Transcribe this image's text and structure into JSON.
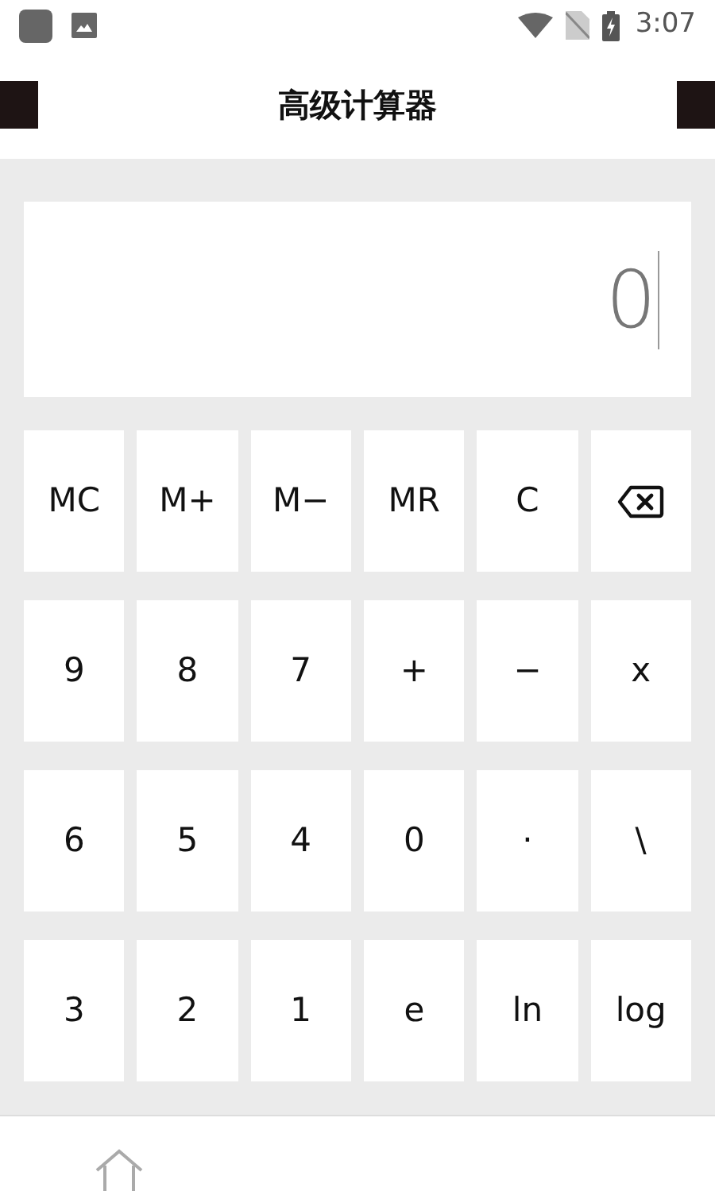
{
  "status_bar": {
    "time": "3:07"
  },
  "header": {
    "title": "高级计算器"
  },
  "display": {
    "value": "0"
  },
  "keys": [
    [
      {
        "kind": "text",
        "label": "MC"
      },
      {
        "kind": "text",
        "label": "M+"
      },
      {
        "kind": "text",
        "label": "M−"
      },
      {
        "kind": "text",
        "label": "MR"
      },
      {
        "kind": "text",
        "label": "C"
      },
      {
        "kind": "backspace"
      }
    ],
    [
      {
        "kind": "text",
        "label": "9"
      },
      {
        "kind": "text",
        "label": "8"
      },
      {
        "kind": "text",
        "label": "7"
      },
      {
        "kind": "text",
        "label": "+"
      },
      {
        "kind": "text",
        "label": "−"
      },
      {
        "kind": "text",
        "label": "x"
      }
    ],
    [
      {
        "kind": "text",
        "label": "6"
      },
      {
        "kind": "text",
        "label": "5"
      },
      {
        "kind": "text",
        "label": "4"
      },
      {
        "kind": "text",
        "label": "0"
      },
      {
        "kind": "text",
        "label": "·"
      },
      {
        "kind": "text",
        "label": "\\"
      }
    ],
    [
      {
        "kind": "text",
        "label": "3"
      },
      {
        "kind": "text",
        "label": "2"
      },
      {
        "kind": "text",
        "label": "1"
      },
      {
        "kind": "text",
        "label": "e"
      },
      {
        "kind": "text",
        "label": "ln"
      },
      {
        "kind": "text",
        "label": "log"
      }
    ]
  ]
}
